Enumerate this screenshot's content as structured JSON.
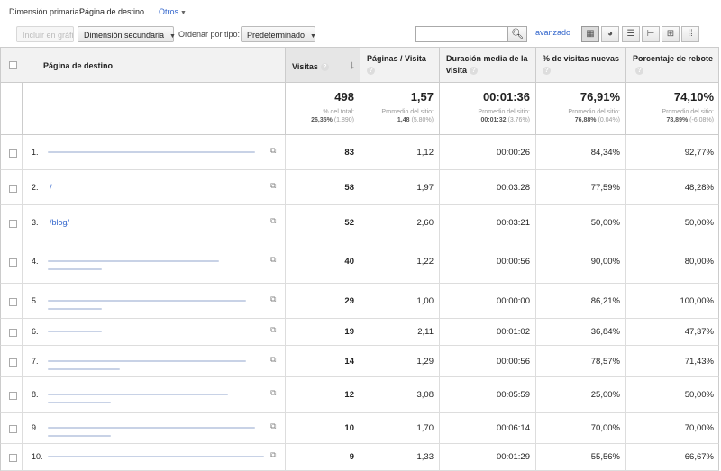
{
  "topbar": {
    "primary_label": "Dimensión primaria:",
    "primary_value": "Página de destino",
    "others_label": "Otros"
  },
  "toolbar": {
    "plot_button": "Incluir en gráfico",
    "secondary_dimension": "Dimensión secundaria",
    "sort_by_label": "Ordenar por tipo:",
    "sort_by_value": "Predeterminado",
    "search_placeholder": "",
    "advanced_link": "avanzado",
    "view_icons": [
      "table-view-icon",
      "pie-view-icon",
      "performance-view-icon",
      "comparison-view-icon",
      "pivot-view-icon",
      "term-cloud-view-icon"
    ]
  },
  "table": {
    "columns": [
      {
        "label": "Página de destino"
      },
      {
        "label": "Visitas"
      },
      {
        "label": "Páginas / Visita"
      },
      {
        "label": "Duración media de la visita"
      },
      {
        "label": "% de visitas nuevas"
      },
      {
        "label": "Porcentaje de rebote"
      }
    ],
    "totals": {
      "visits": {
        "value": "498",
        "line1": "% del total:",
        "line2_bold": "26,35%",
        "line2_muted": "(1.890)"
      },
      "pages": {
        "value": "1,57",
        "line1": "Promedio del sitio:",
        "line2_bold": "1,48",
        "line2_muted": "(5,80%)"
      },
      "duration": {
        "value": "00:01:36",
        "line1": "Promedio del sitio:",
        "line2_bold": "00:01:32",
        "line2_muted": "(3,76%)"
      },
      "new": {
        "value": "76,91%",
        "line1": "Promedio del sitio:",
        "line2_bold": "76,88%",
        "line2_muted": "(0,04%)"
      },
      "bounce": {
        "value": "74,10%",
        "line1": "Promedio del sitio:",
        "line2_bold": "78,89%",
        "line2_muted": "(-6,08%)"
      }
    },
    "rows": [
      {
        "idx": "1.",
        "path": "",
        "visits": "83",
        "pages": "1,12",
        "duration": "00:00:26",
        "new": "84,34%",
        "bounce": "92,77%"
      },
      {
        "idx": "2.",
        "path": "/",
        "visits": "58",
        "pages": "1,97",
        "duration": "00:03:28",
        "new": "77,59%",
        "bounce": "48,28%"
      },
      {
        "idx": "3.",
        "path": "/blog/",
        "visits": "52",
        "pages": "2,60",
        "duration": "00:03:21",
        "new": "50,00%",
        "bounce": "50,00%"
      },
      {
        "idx": "4.",
        "path": "",
        "visits": "40",
        "pages": "1,22",
        "duration": "00:00:56",
        "new": "90,00%",
        "bounce": "80,00%"
      },
      {
        "idx": "5.",
        "path": "",
        "visits": "29",
        "pages": "1,00",
        "duration": "00:00:00",
        "new": "86,21%",
        "bounce": "100,00%"
      },
      {
        "idx": "6.",
        "path": "",
        "visits": "19",
        "pages": "2,11",
        "duration": "00:01:02",
        "new": "36,84%",
        "bounce": "47,37%"
      },
      {
        "idx": "7.",
        "path": "",
        "visits": "14",
        "pages": "1,29",
        "duration": "00:00:56",
        "new": "78,57%",
        "bounce": "71,43%"
      },
      {
        "idx": "8.",
        "path": "",
        "visits": "12",
        "pages": "3,08",
        "duration": "00:05:59",
        "new": "25,00%",
        "bounce": "50,00%"
      },
      {
        "idx": "9.",
        "path": "",
        "visits": "10",
        "pages": "1,70",
        "duration": "00:06:14",
        "new": "70,00%",
        "bounce": "70,00%"
      },
      {
        "idx": "10.",
        "path": "",
        "visits": "9",
        "pages": "1,33",
        "duration": "00:01:29",
        "new": "55,56%",
        "bounce": "66,67%"
      }
    ]
  }
}
